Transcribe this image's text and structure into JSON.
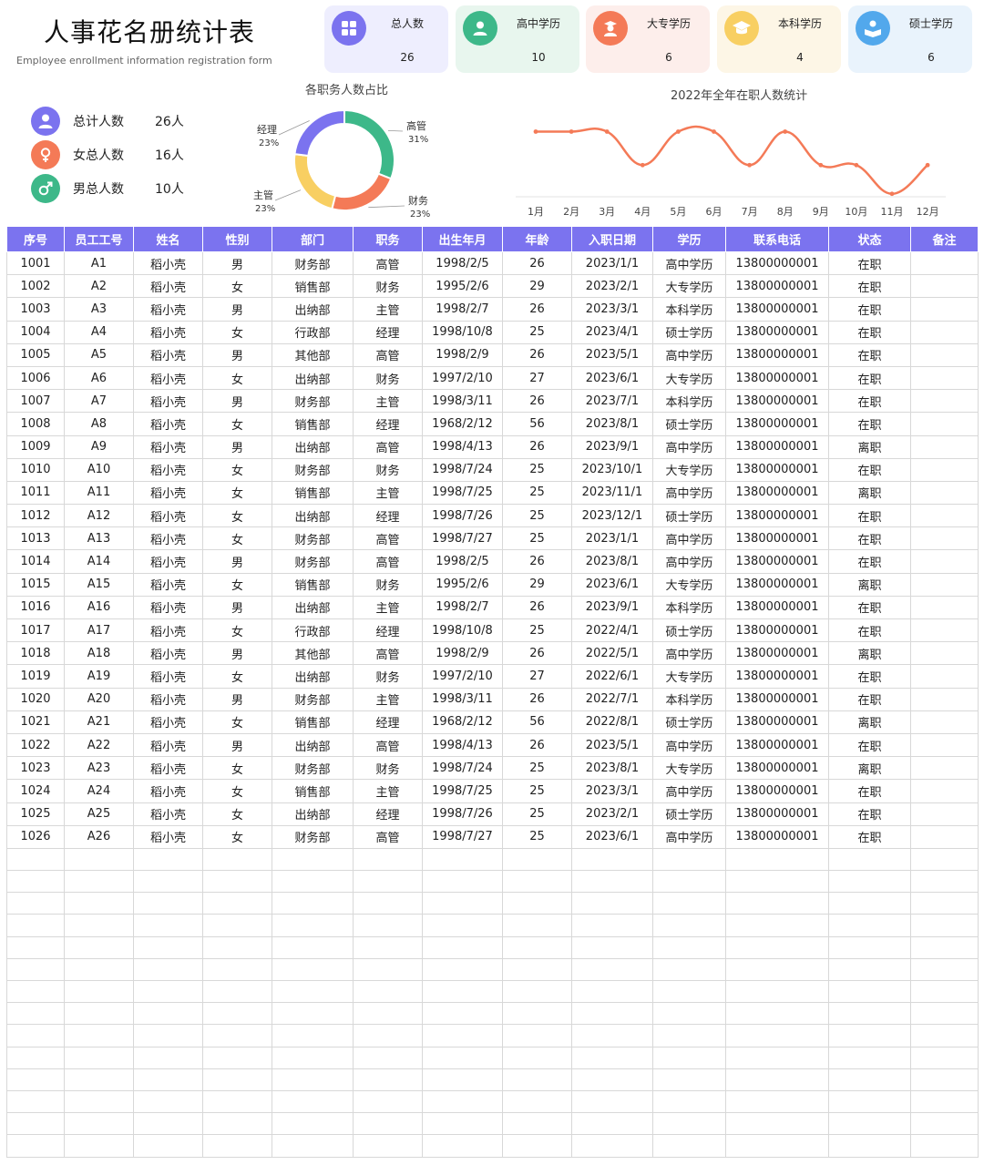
{
  "header": {
    "title": "人事花名册统计表",
    "subtitle": "Employee enrollment information registration form"
  },
  "cards": [
    {
      "label": "总人数",
      "value": "26",
      "bg": "#eeeefe",
      "icon_bg": "#7b73ef",
      "icon": "grid-icon"
    },
    {
      "label": "高中学历",
      "value": "10",
      "bg": "#e8f6ee",
      "icon_bg": "#3db889",
      "icon": "person-icon"
    },
    {
      "label": "大专学历",
      "value": "6",
      "bg": "#fdeeeb",
      "icon_bg": "#f47a57",
      "icon": "graduate-icon"
    },
    {
      "label": "本科学历",
      "value": "4",
      "bg": "#fdf6e6",
      "icon_bg": "#f8cf62",
      "icon": "grad-cap-icon"
    },
    {
      "label": "硕士学历",
      "value": "6",
      "bg": "#e9f3fc",
      "icon_bg": "#52a8ec",
      "icon": "reader-icon"
    }
  ],
  "stats": [
    {
      "label": "总计人数",
      "value": "26人",
      "icon_bg": "#7b73ef",
      "icon": "person-icon"
    },
    {
      "label": "女总人数",
      "value": "16人",
      "icon_bg": "#f47a57",
      "icon": "female-icon"
    },
    {
      "label": "男总人数",
      "value": "10人",
      "icon_bg": "#3db889",
      "icon": "male-icon"
    }
  ],
  "chart_data": [
    {
      "type": "pie",
      "title": "各职务人数占比",
      "slices": [
        {
          "label": "高管",
          "value": 31,
          "value_label": "31%",
          "color": "#3db889"
        },
        {
          "label": "财务",
          "value": 23,
          "value_label": "23%",
          "color": "#f47a57"
        },
        {
          "label": "主管",
          "value": 23,
          "value_label": "23%",
          "color": "#f8cf62"
        },
        {
          "label": "经理",
          "value": 23,
          "value_label": "23%",
          "color": "#7b73ef"
        }
      ]
    },
    {
      "type": "line",
      "title": "2022年全年在职人数统计",
      "categories": [
        "1月",
        "2月",
        "3月",
        "4月",
        "5月",
        "6月",
        "7月",
        "8月",
        "9月",
        "10月",
        "11月",
        "12月"
      ],
      "values": [
        10,
        10,
        10,
        3,
        10,
        10,
        3,
        10,
        3,
        3,
        -3,
        3
      ],
      "ylim": [
        -4,
        12
      ],
      "color": "#f47a57"
    }
  ],
  "table": {
    "header_bg": "#7b73ef",
    "columns": [
      "序号",
      "员工工号",
      "姓名",
      "性别",
      "部门",
      "职务",
      "出生年月",
      "年龄",
      "入职日期",
      "学历",
      "联系电话",
      "状态",
      "备注"
    ],
    "rows": [
      [
        "1001",
        "A1",
        "稻小壳",
        "男",
        "财务部",
        "高管",
        "1998/2/5",
        "26",
        "2023/1/1",
        "高中学历",
        "13800000001",
        "在职",
        ""
      ],
      [
        "1002",
        "A2",
        "稻小壳",
        "女",
        "销售部",
        "财务",
        "1995/2/6",
        "29",
        "2023/2/1",
        "大专学历",
        "13800000001",
        "在职",
        ""
      ],
      [
        "1003",
        "A3",
        "稻小壳",
        "男",
        "出纳部",
        "主管",
        "1998/2/7",
        "26",
        "2023/3/1",
        "本科学历",
        "13800000001",
        "在职",
        ""
      ],
      [
        "1004",
        "A4",
        "稻小壳",
        "女",
        "行政部",
        "经理",
        "1998/10/8",
        "25",
        "2023/4/1",
        "硕士学历",
        "13800000001",
        "在职",
        ""
      ],
      [
        "1005",
        "A5",
        "稻小壳",
        "男",
        "其他部",
        "高管",
        "1998/2/9",
        "26",
        "2023/5/1",
        "高中学历",
        "13800000001",
        "在职",
        ""
      ],
      [
        "1006",
        "A6",
        "稻小壳",
        "女",
        "出纳部",
        "财务",
        "1997/2/10",
        "27",
        "2023/6/1",
        "大专学历",
        "13800000001",
        "在职",
        ""
      ],
      [
        "1007",
        "A7",
        "稻小壳",
        "男",
        "财务部",
        "主管",
        "1998/3/11",
        "26",
        "2023/7/1",
        "本科学历",
        "13800000001",
        "在职",
        ""
      ],
      [
        "1008",
        "A8",
        "稻小壳",
        "女",
        "销售部",
        "经理",
        "1968/2/12",
        "56",
        "2023/8/1",
        "硕士学历",
        "13800000001",
        "在职",
        ""
      ],
      [
        "1009",
        "A9",
        "稻小壳",
        "男",
        "出纳部",
        "高管",
        "1998/4/13",
        "26",
        "2023/9/1",
        "高中学历",
        "13800000001",
        "离职",
        ""
      ],
      [
        "1010",
        "A10",
        "稻小壳",
        "女",
        "财务部",
        "财务",
        "1998/7/24",
        "25",
        "2023/10/1",
        "大专学历",
        "13800000001",
        "在职",
        ""
      ],
      [
        "1011",
        "A11",
        "稻小壳",
        "女",
        "销售部",
        "主管",
        "1998/7/25",
        "25",
        "2023/11/1",
        "高中学历",
        "13800000001",
        "离职",
        ""
      ],
      [
        "1012",
        "A12",
        "稻小壳",
        "女",
        "出纳部",
        "经理",
        "1998/7/26",
        "25",
        "2023/12/1",
        "硕士学历",
        "13800000001",
        "在职",
        ""
      ],
      [
        "1013",
        "A13",
        "稻小壳",
        "女",
        "财务部",
        "高管",
        "1998/7/27",
        "25",
        "2023/1/1",
        "高中学历",
        "13800000001",
        "在职",
        ""
      ],
      [
        "1014",
        "A14",
        "稻小壳",
        "男",
        "财务部",
        "高管",
        "1998/2/5",
        "26",
        "2023/8/1",
        "高中学历",
        "13800000001",
        "在职",
        ""
      ],
      [
        "1015",
        "A15",
        "稻小壳",
        "女",
        "销售部",
        "财务",
        "1995/2/6",
        "29",
        "2023/6/1",
        "大专学历",
        "13800000001",
        "离职",
        ""
      ],
      [
        "1016",
        "A16",
        "稻小壳",
        "男",
        "出纳部",
        "主管",
        "1998/2/7",
        "26",
        "2023/9/1",
        "本科学历",
        "13800000001",
        "在职",
        ""
      ],
      [
        "1017",
        "A17",
        "稻小壳",
        "女",
        "行政部",
        "经理",
        "1998/10/8",
        "25",
        "2022/4/1",
        "硕士学历",
        "13800000001",
        "在职",
        ""
      ],
      [
        "1018",
        "A18",
        "稻小壳",
        "男",
        "其他部",
        "高管",
        "1998/2/9",
        "26",
        "2022/5/1",
        "高中学历",
        "13800000001",
        "离职",
        ""
      ],
      [
        "1019",
        "A19",
        "稻小壳",
        "女",
        "出纳部",
        "财务",
        "1997/2/10",
        "27",
        "2022/6/1",
        "大专学历",
        "13800000001",
        "在职",
        ""
      ],
      [
        "1020",
        "A20",
        "稻小壳",
        "男",
        "财务部",
        "主管",
        "1998/3/11",
        "26",
        "2022/7/1",
        "本科学历",
        "13800000001",
        "在职",
        ""
      ],
      [
        "1021",
        "A21",
        "稻小壳",
        "女",
        "销售部",
        "经理",
        "1968/2/12",
        "56",
        "2022/8/1",
        "硕士学历",
        "13800000001",
        "离职",
        ""
      ],
      [
        "1022",
        "A22",
        "稻小壳",
        "男",
        "出纳部",
        "高管",
        "1998/4/13",
        "26",
        "2023/5/1",
        "高中学历",
        "13800000001",
        "在职",
        ""
      ],
      [
        "1023",
        "A23",
        "稻小壳",
        "女",
        "财务部",
        "财务",
        "1998/7/24",
        "25",
        "2023/8/1",
        "大专学历",
        "13800000001",
        "离职",
        ""
      ],
      [
        "1024",
        "A24",
        "稻小壳",
        "女",
        "销售部",
        "主管",
        "1998/7/25",
        "25",
        "2023/3/1",
        "高中学历",
        "13800000001",
        "在职",
        ""
      ],
      [
        "1025",
        "A25",
        "稻小壳",
        "女",
        "出纳部",
        "经理",
        "1998/7/26",
        "25",
        "2023/2/1",
        "硕士学历",
        "13800000001",
        "在职",
        ""
      ],
      [
        "1026",
        "A26",
        "稻小壳",
        "女",
        "财务部",
        "高管",
        "1998/7/27",
        "25",
        "2023/6/1",
        "高中学历",
        "13800000001",
        "在职",
        ""
      ]
    ],
    "empty_rows": 14
  }
}
